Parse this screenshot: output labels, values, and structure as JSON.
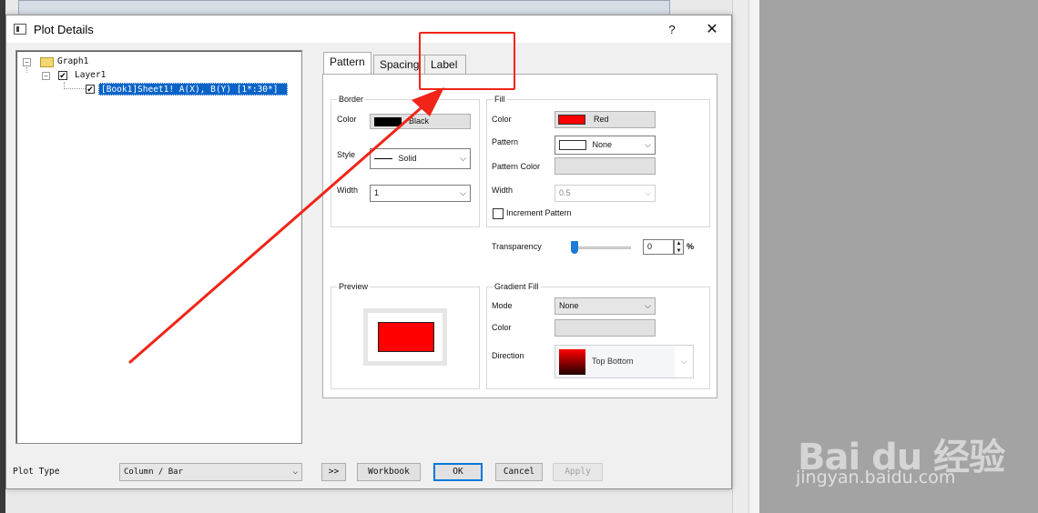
{
  "window": {
    "title": "Plot Details",
    "help": "?",
    "close": "✕"
  },
  "tree": {
    "graph": "Graph1",
    "layer": "Layer1",
    "plot": "[Book1]Sheet1! A(X), B(Y) [1*:30*]",
    "exp1": "−",
    "exp2": "−",
    "check": "✔"
  },
  "tabs": {
    "pattern": "Pattern",
    "spacing": "Spacing",
    "label": "Label"
  },
  "border": {
    "title": "Border",
    "color_label": "Color",
    "color_value": "Black",
    "color_hex": "#000000",
    "style_label": "Style",
    "style_value": "Solid",
    "width_label": "Width",
    "width_value": "1"
  },
  "fill": {
    "title": "Fill",
    "color_label": "Color",
    "color_value": "Red",
    "color_hex": "#ff0000",
    "pattern_label": "Pattern",
    "pattern_value": "None",
    "pattern_color_label": "Pattern Color",
    "width_label": "Width",
    "width_value": "0.5",
    "increment_label": "Increment Pattern"
  },
  "transparency": {
    "label": "Transparency",
    "value": "0",
    "unit": "%",
    "level": 0
  },
  "preview": {
    "title": "Preview"
  },
  "gradient": {
    "title": "Gradient Fill",
    "mode_label": "Mode",
    "mode_value": "None",
    "color_label": "Color",
    "direction_label": "Direction",
    "direction_value": "Top Bottom"
  },
  "bottom": {
    "plot_type_label": "Plot Type",
    "plot_type_value": "Column / Bar",
    "expand": ">>",
    "workbook": "Workbook",
    "ok": "OK",
    "cancel": "Cancel",
    "apply": "Apply"
  },
  "watermark": {
    "logo": "Bai du 经验",
    "url": "jingyan.baidu.com"
  },
  "colors": {
    "accent": "#0a64c8",
    "annotation": "#f02418"
  }
}
